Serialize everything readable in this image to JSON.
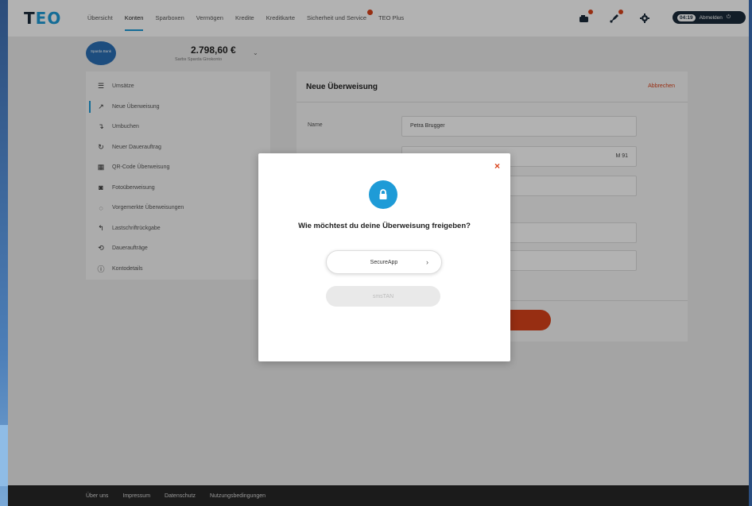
{
  "header": {
    "logo_main": "T",
    "logo_accent": "EO",
    "nav": [
      {
        "label": "Übersicht",
        "active": false,
        "badge": false
      },
      {
        "label": "Konten",
        "active": true,
        "badge": false
      },
      {
        "label": "Sparboxen",
        "active": false,
        "badge": false
      },
      {
        "label": "Vermögen",
        "active": false,
        "badge": false
      },
      {
        "label": "Kredite",
        "active": false,
        "badge": false
      },
      {
        "label": "Kreditkarte",
        "active": false,
        "badge": false
      },
      {
        "label": "Sicherheit und Service",
        "active": false,
        "badge": true
      },
      {
        "label": "TEO Plus",
        "active": false,
        "badge": false
      }
    ],
    "icons": [
      "mailbox-icon",
      "rocket-icon",
      "gear-icon"
    ],
    "session_time": "04:19",
    "logout_label": "Abmelden"
  },
  "account": {
    "bank_logo_text": "Sparda Bank",
    "balance": "2.798,60 €",
    "subtitle": "Sarbs Sparda Girokonto"
  },
  "sidebar": {
    "items": [
      {
        "label": "Umsätze",
        "icon": "list-icon",
        "active": false
      },
      {
        "label": "Neue Überweisung",
        "icon": "arrow-up-right-icon",
        "active": true
      },
      {
        "label": "Umbuchen",
        "icon": "transfer-icon",
        "active": false
      },
      {
        "label": "Neuer Dauerauftrag",
        "icon": "repeat-icon",
        "active": false
      },
      {
        "label": "QR-Code Überweisung",
        "icon": "qr-code-icon",
        "active": false
      },
      {
        "label": "Fotoüberweisung",
        "icon": "camera-icon",
        "active": false
      },
      {
        "label": "Vorgemerkte Überweisungen",
        "icon": "clock-icon",
        "active": false
      },
      {
        "label": "Lastschriftrückgabe",
        "icon": "return-arrow-icon",
        "active": false
      },
      {
        "label": "Daueraufträge",
        "icon": "history-icon",
        "active": false
      },
      {
        "label": "Kontodetails",
        "icon": "info-icon",
        "active": false
      }
    ]
  },
  "transfer": {
    "title": "Neue Überweisung",
    "cancel_label": "Abbrechen",
    "name_label": "Name",
    "name_value": "Petra Brugger",
    "iban_fragment": "M 91"
  },
  "modal": {
    "close_label": "×",
    "question": "Wie möchtest du deine Überweisung freigeben?",
    "option_secureapp": "SecureApp",
    "option_smstan": "smsTAN"
  },
  "footer": {
    "links": [
      "Über uns",
      "Impressum",
      "Datenschutz",
      "Nutzungsbedingungen"
    ]
  },
  "colors": {
    "accent": "#1e9bd7",
    "brand_orange": "#d9421a",
    "dark": "#1a2a3a"
  }
}
